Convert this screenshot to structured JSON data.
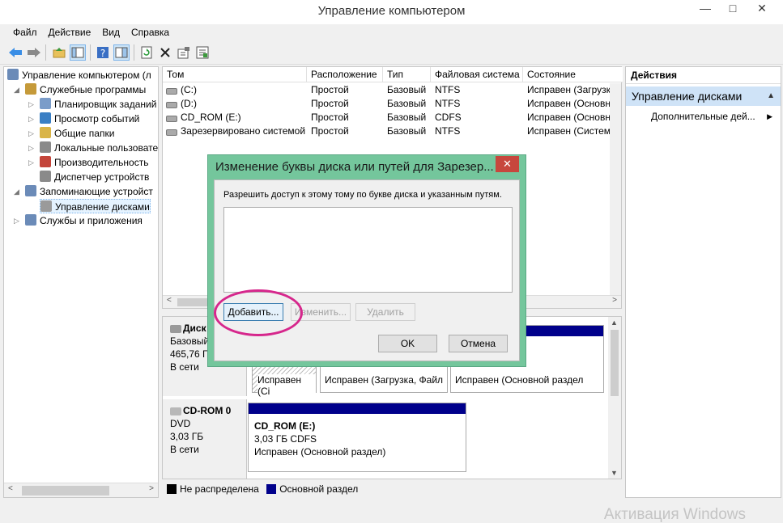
{
  "window": {
    "title": "Управление компьютером",
    "minimize_glyph": "—",
    "maximize_glyph": "□",
    "close_glyph": "✕"
  },
  "menu": [
    "Файл",
    "Действие",
    "Вид",
    "Справка"
  ],
  "toolbar": {
    "icons": [
      "back-arrow-icon",
      "forward-arrow-icon",
      "up-folder-icon",
      "show-hide-tree-icon",
      "help-icon",
      "properties-view-icon",
      "refresh-icon",
      "delete-icon",
      "properties-icon",
      "export-icon"
    ]
  },
  "tree": {
    "root": "Управление компьютером (л",
    "items": [
      {
        "label": "Служебные программы",
        "level": 1,
        "expander": "◢"
      },
      {
        "label": "Планировщик заданий",
        "level": 2,
        "expander": "▷"
      },
      {
        "label": "Просмотр событий",
        "level": 2,
        "expander": "▷"
      },
      {
        "label": "Общие папки",
        "level": 2,
        "expander": "▷"
      },
      {
        "label": "Локальные пользовате",
        "level": 2,
        "expander": "▷"
      },
      {
        "label": "Производительность",
        "level": 2,
        "expander": "▷"
      },
      {
        "label": "Диспетчер устройств",
        "level": 2,
        "expander": ""
      },
      {
        "label": "Запоминающие устройст",
        "level": 1,
        "expander": "◢"
      },
      {
        "label": "Управление дисками",
        "level": 2,
        "expander": "",
        "selected": true
      },
      {
        "label": "Службы и приложения",
        "level": 1,
        "expander": "▷"
      }
    ]
  },
  "volumes": {
    "columns": [
      "Том",
      "Расположение",
      "Тип",
      "Файловая система",
      "Состояние"
    ],
    "rows": [
      [
        "(C:)",
        "Простой",
        "Базовый",
        "NTFS",
        "Исправен (Загрузка,"
      ],
      [
        "(D:)",
        "Простой",
        "Базовый",
        "NTFS",
        "Исправен (Основной"
      ],
      [
        "CD_ROM (E:)",
        "Простой",
        "Базовый",
        "CDFS",
        "Исправен (Основной"
      ],
      [
        "Зарезервировано системой",
        "Простой",
        "Базовый",
        "NTFS",
        "Исправен (Система, "
      ]
    ]
  },
  "disks": [
    {
      "name": "Диск",
      "lines": [
        "Базовый",
        "465,76 ГБ",
        "В сети"
      ],
      "partitions": [
        {
          "lines": [
            "Исправен (Сі"
          ]
        },
        {
          "lines": [
            "Исправен (Загрузка, Файл"
          ]
        },
        {
          "lines": [
            "Исправен (Основной раздел"
          ]
        }
      ]
    },
    {
      "name": "CD-ROM 0",
      "lines": [
        "DVD",
        "3,03 ГБ",
        "В сети"
      ],
      "partitions": [
        {
          "title": "CD_ROM  (E:)",
          "lines": [
            "3,03 ГБ CDFS",
            "Исправен (Основной раздел)"
          ]
        }
      ]
    }
  ],
  "legend": [
    {
      "label": "Не распределена",
      "color": "#000000"
    },
    {
      "label": "Основной раздел",
      "color": "#00008b"
    }
  ],
  "actions": {
    "header": "Действия",
    "section": "Управление дисками",
    "item": "Дополнительные дей..."
  },
  "dialog": {
    "title": "Изменение буквы диска или путей для Зарезер...",
    "description": "Разрешить доступ к этому тому по букве диска и указанным путям.",
    "add_label": "Добавить...",
    "change_label": "Изменить...",
    "delete_label": "Удалить",
    "ok_label": "OK",
    "cancel_label": "Отмена",
    "close_glyph": "✕"
  },
  "watermark": "Активация Windows",
  "colors": {
    "dialog_frame": "#74c69c",
    "close_button": "#c7473d",
    "highlight": "#d6278c",
    "primary_partition": "#00008b"
  }
}
